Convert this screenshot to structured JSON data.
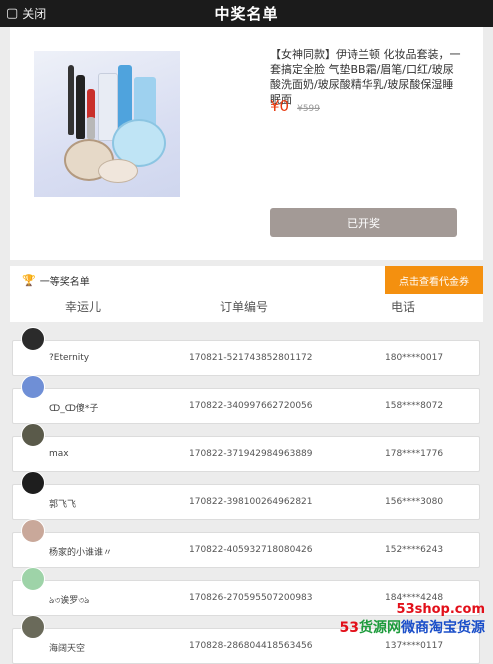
{
  "topbar": {
    "close_label": "关闭",
    "close_icon": "close-icon",
    "title": "中奖名单"
  },
  "product": {
    "description": "【女神同款】伊诗兰顿 化妆品套装，一套搞定全脸 气垫BB霜/眉笔/口红/玻尿酸洗面奶/玻尿酸精华乳/玻尿酸保湿睡眠面",
    "price": "¥0",
    "original_price": "¥599",
    "status_button": "已开奖"
  },
  "first_prize": {
    "label": "一等奖名单",
    "icon": "trophy-icon",
    "coupon_button": "点击查看代金券"
  },
  "columns": {
    "winner": "幸运儿",
    "order": "订单编号",
    "phone": "电话"
  },
  "winners": [
    {
      "name": "?Eternity",
      "order": "170821-521743852801172",
      "phone": "180****0017",
      "avatar_color": "#2b2b2b"
    },
    {
      "name": "ↀ_ↀ傻*子",
      "order": "170822-340997662720056",
      "phone": "158****8072",
      "avatar_color": "#6f8fd6"
    },
    {
      "name": "max",
      "order": "170822-371942984963889",
      "phone": "178****1776",
      "avatar_color": "#5a5a4a"
    },
    {
      "name": "郭飞飞",
      "order": "170822-398100264962821",
      "phone": "156****3080",
      "avatar_color": "#1e1e1e"
    },
    {
      "name": "杨家的小谁谁〃",
      "order": "170822-405932718080426",
      "phone": "152****6243",
      "avatar_color": "#c9a89a"
    },
    {
      "name": "ঌ৩诶罗৩ঌ",
      "order": "170826-270595507200983",
      "phone": "184****4248",
      "avatar_color": "#9ed3a8"
    },
    {
      "name": "海阔天空",
      "order": "170828-286804418563456",
      "phone": "137****0117",
      "avatar_color": "#6a6a5a"
    }
  ],
  "watermark": {
    "site": "53shop.com",
    "brand_53": "53",
    "brand_mid": "货源网",
    "brand_tail": "微商淘宝货源"
  }
}
